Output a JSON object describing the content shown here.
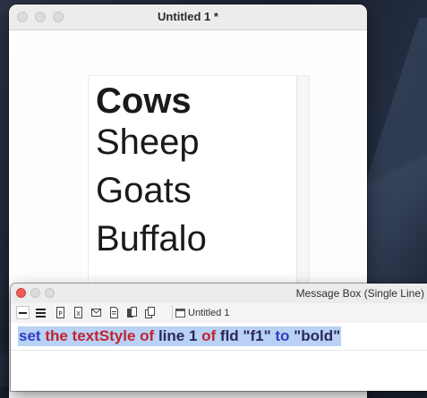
{
  "stack_window": {
    "title": "Untitled 1 *"
  },
  "field": {
    "name": "f1",
    "lines": [
      {
        "text": "Cows",
        "bold": true
      },
      {
        "text": "Sheep",
        "bold": false
      },
      {
        "text": "Goats",
        "bold": false
      },
      {
        "text": "Buffalo",
        "bold": false
      }
    ]
  },
  "message_box": {
    "title": "Message Box (Single Line)",
    "stack_selector": "Untitled 1",
    "command": [
      {
        "text": "set",
        "style": "blue"
      },
      {
        "text": " ",
        "style": "dark"
      },
      {
        "text": "the",
        "style": "red"
      },
      {
        "text": " ",
        "style": "dark"
      },
      {
        "text": "textStyle",
        "style": "red"
      },
      {
        "text": " ",
        "style": "dark"
      },
      {
        "text": "of",
        "style": "red"
      },
      {
        "text": " ",
        "style": "dark"
      },
      {
        "text": "line",
        "style": "dark"
      },
      {
        "text": " 1 ",
        "style": "dark"
      },
      {
        "text": "of",
        "style": "red"
      },
      {
        "text": " ",
        "style": "dark"
      },
      {
        "text": "fld",
        "style": "dark"
      },
      {
        "text": " \"f1\" ",
        "style": "dark"
      },
      {
        "text": "to",
        "style": "blue"
      },
      {
        "text": " \"bold\"",
        "style": "dark"
      }
    ],
    "toolbar_icons": [
      "single-line-icon",
      "multi-line-icon",
      "global-properties-icon",
      "global-variables-icon",
      "pending-messages-icon",
      "front-scripts-icon",
      "back-scripts-icon",
      "message-history-icon"
    ]
  },
  "colors": {
    "keyword_blue": "#2c3fc4",
    "keyword_red": "#c0242e",
    "selection": "#b8d1f5",
    "close_red": "#ec5f56"
  }
}
